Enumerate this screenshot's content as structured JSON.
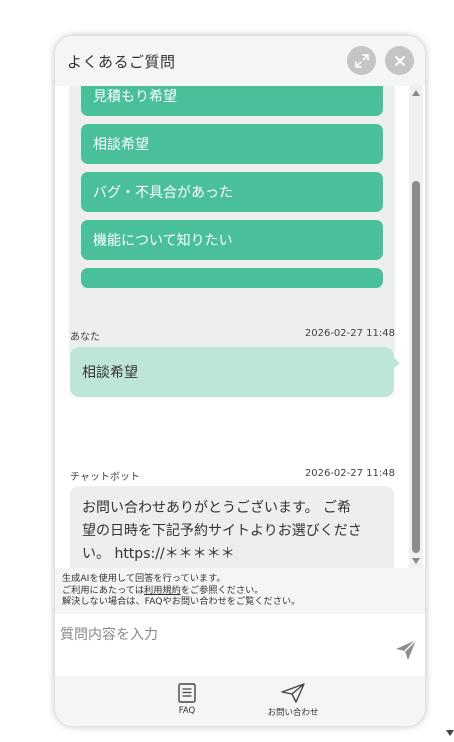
{
  "header": {
    "title": "よくあるご質問"
  },
  "options": [
    {
      "label": "見積もり希望"
    },
    {
      "label": "相談希望"
    },
    {
      "label": "バグ・不具合があった"
    },
    {
      "label": "機能について知りたい"
    }
  ],
  "messages": {
    "user": {
      "sender": "あなた",
      "time": "2026-02-27 11:48",
      "text": "相談希望"
    },
    "bot": {
      "sender": "チャットボット",
      "time": "2026-02-27 11:48",
      "line1": "お問い合わせありがとうございます。 ご希",
      "line2": "望の日時を下記予約サイトよりお選びくださ",
      "line3": "い。 https://＊＊＊＊＊"
    }
  },
  "notice": {
    "line1": "生成AIを使用して回答を行っています。",
    "line2_prefix": "ご利用にあたっては",
    "line2_link": "利用規約",
    "line2_suffix": "をご参照ください。",
    "line3": "解決しない場合は、FAQやお問い合わせをご覧ください。"
  },
  "input": {
    "placeholder": "質問内容を入力"
  },
  "footer": {
    "faq_label": "FAQ",
    "contact_label": "お問い合わせ"
  },
  "colors": {
    "accent": "#49c09b",
    "user_bubble": "#bde6d7",
    "bot_bubble": "#eceeef",
    "header_bg": "#f4f5f6"
  },
  "icons": {
    "expand": "expand-icon",
    "close": "close-icon",
    "send": "send-icon",
    "faq": "document-icon",
    "contact": "paper-plane-icon"
  }
}
